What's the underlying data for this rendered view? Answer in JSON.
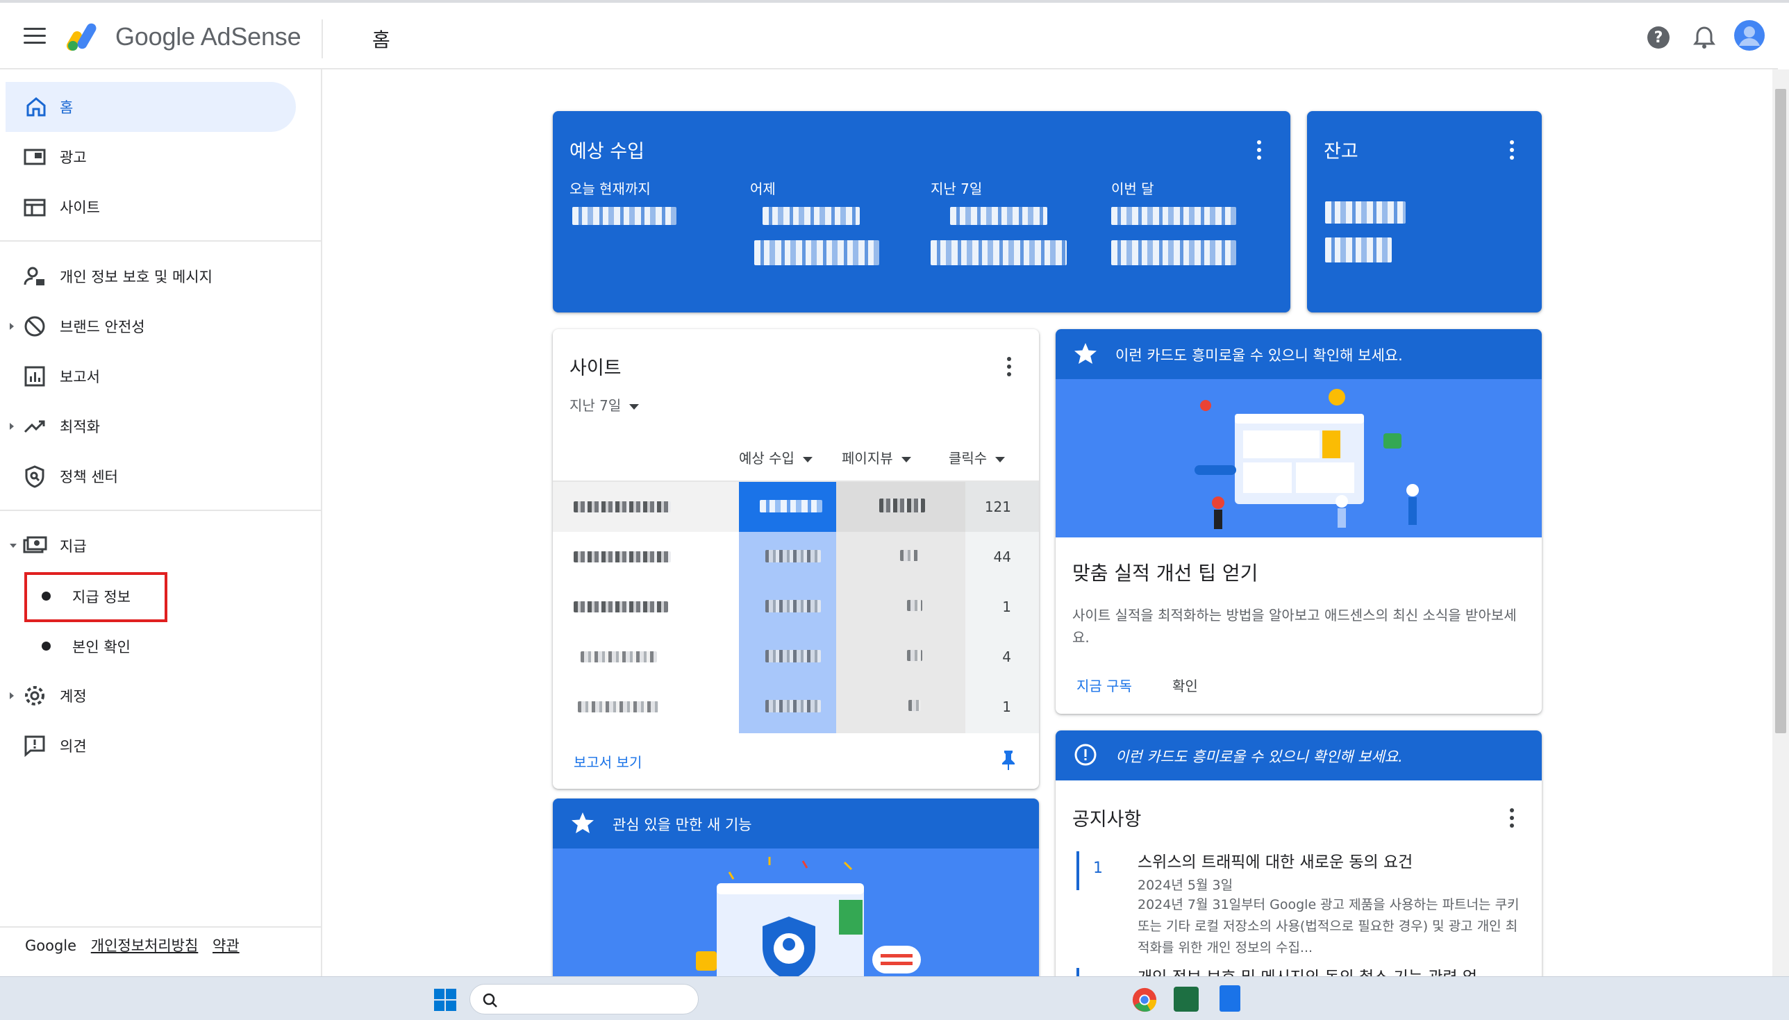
{
  "header": {
    "brand": "Google AdSense",
    "page_title": "홈"
  },
  "sidebar": {
    "items": [
      {
        "label": "홈"
      },
      {
        "label": "광고"
      },
      {
        "label": "사이트"
      },
      {
        "label": "개인 정보 보호 및 메시지"
      },
      {
        "label": "브랜드 안전성"
      },
      {
        "label": "보고서"
      },
      {
        "label": "최적화"
      },
      {
        "label": "정책 센터"
      },
      {
        "label": "지급"
      },
      {
        "label": "지급 정보"
      },
      {
        "label": "본인 확인"
      },
      {
        "label": "계정"
      },
      {
        "label": "의견"
      }
    ],
    "footer": {
      "google": "Google",
      "privacy": "개인정보처리방침",
      "terms": "약관"
    }
  },
  "earnings_card": {
    "title": "예상 수입",
    "metrics": [
      {
        "label": "오늘 현재까지"
      },
      {
        "label": "어제"
      },
      {
        "label": "지난 7일"
      },
      {
        "label": "이번 달"
      }
    ]
  },
  "balance_card": {
    "title": "잔고"
  },
  "sites_card": {
    "title": "사이트",
    "period": "지난 7일",
    "columns": [
      "예상 수입",
      "페이지뷰",
      "클릭수"
    ],
    "rows": [
      {
        "clicks": "121"
      },
      {
        "clicks": "44"
      },
      {
        "clicks": "1"
      },
      {
        "clicks": "4"
      },
      {
        "clicks": "1"
      }
    ],
    "report_link": "보고서 보기"
  },
  "tips_card": {
    "header": "이런 카드도 흥미로울 수 있으니 확인해 보세요.",
    "title": "맞춤 실적 개선 팁 얻기",
    "body": "사이트 실적을 최적화하는 방법을 알아보고 애드센스의 최신 소식을 받아보세요.",
    "subscribe": "지금 구독",
    "confirm": "확인"
  },
  "features_card": {
    "header": "관심 있을 만한 새 기능"
  },
  "notice_card": {
    "header": "이런 카드도 흥미로울 수 있으니 확인해 보세요.",
    "title": "공지사항",
    "items": [
      {
        "num": "1",
        "title": "스위스의 트래픽에 대한 새로운 동의 요건",
        "date": "2024년 5월 3일",
        "body": "2024년 7월 31일부터 Google 광고 제품을 사용하는 파트너는 쿠키 또는 기타 로컬 저장소의 사용(법적으로 필요한 경우) 및 광고 개인 최적화를 위한 개인 정보의 수집..."
      }
    ],
    "next_title_partial": "개인 정보 보호 및 메시지의 동의 철소 기능 관련 업"
  },
  "colors": {
    "primary": "#1967d2",
    "highlight": "#e02020"
  }
}
